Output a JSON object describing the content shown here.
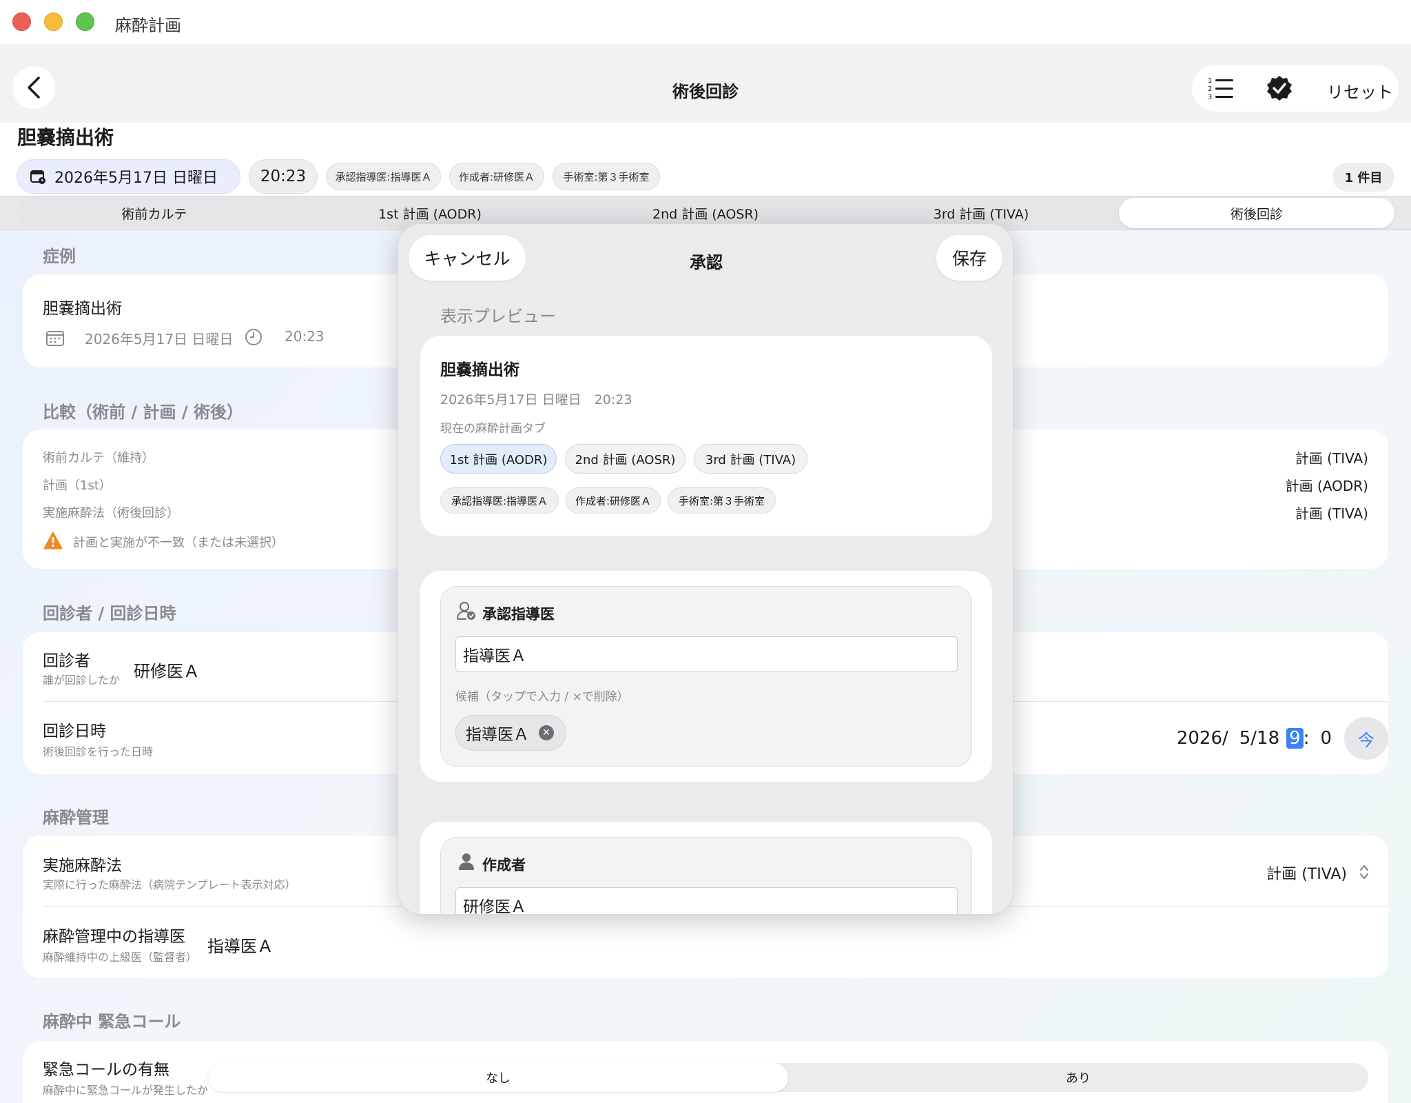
{
  "window": {
    "title": "麻酔計画"
  },
  "nav": {
    "title": "術後回診",
    "reset_label": "リセット"
  },
  "header": {
    "case_title": "胆嚢摘出術",
    "date": "2026年5月17日 日曜日",
    "time": "20:23",
    "chips": {
      "approver": "承認指導医:指導医Ａ",
      "author": "作成者:研修医Ａ",
      "room": "手術室:第３手術室"
    },
    "count": "1 件目"
  },
  "tabs": [
    "術前カルテ",
    "1st 計画 (AODR)",
    "2nd 計画 (AOSR)",
    "3rd 計画 (TIVA)",
    "術後回診"
  ],
  "sections": {
    "case": {
      "heading": "症例",
      "title": "胆嚢摘出術",
      "date": "2026年5月17日 日曜日",
      "time": "20:23"
    },
    "compare": {
      "heading": "比較（術前 / 計画 / 術後）",
      "rows": [
        {
          "label": "術前カルテ（維持）",
          "value": "計画 (TIVA)"
        },
        {
          "label": "計画（1st）",
          "value": "計画 (AODR)"
        },
        {
          "label": "実施麻酔法（術後回診）",
          "value": "計画 (TIVA)"
        }
      ],
      "warning": "計画と実施が不一致（または未選択）"
    },
    "visit": {
      "heading": "回診者 / 回診日時",
      "visitor_label": "回診者",
      "visitor_sub": "誰が回診したか",
      "visitor_value": "研修医Ａ",
      "datetime_label": "回診日時",
      "datetime_sub": "術後回診を行った日時",
      "date_year": "2026/",
      "date_md": "5/18",
      "hour": "9",
      "colon": ":",
      "minute": "0",
      "now_label": "今"
    },
    "anesthesia": {
      "heading": "麻酔管理",
      "method_label": "実施麻酔法",
      "method_sub": "実際に行った麻酔法（病院テンプレート表示対応）",
      "method_value": "計画 (TIVA)",
      "supervisor_label": "麻酔管理中の指導医",
      "supervisor_sub": "麻酔維持中の上級医（監督者）",
      "supervisor_value": "指導医Ａ"
    },
    "emergency": {
      "heading": "麻酔中 緊急コール",
      "label": "緊急コールの有無",
      "sub": "麻酔中に緊急コールが発生したか",
      "options": [
        "なし",
        "あり"
      ]
    }
  },
  "modal": {
    "title": "承認",
    "cancel_label": "キャンセル",
    "save_label": "保存",
    "preview_heading": "表示プレビュー",
    "preview": {
      "title": "胆嚢摘出術",
      "date": "2026年5月17日 日曜日　20:23",
      "caption": "現在の麻酔計画タブ",
      "tabs": [
        "1st 計画 (AODR)",
        "2nd 計画 (AOSR)",
        "3rd 計画 (TIVA)"
      ],
      "chips": {
        "approver": "承認指導医:指導医Ａ",
        "author": "作成者:研修医Ａ",
        "room": "手術室:第３手術室"
      }
    },
    "approver": {
      "heading": "承認指導医",
      "value": "指導医Ａ",
      "candidates_caption": "候補（タップで入力 / ×で削除）",
      "candidates": [
        "指導医Ａ"
      ]
    },
    "author": {
      "heading": "作成者",
      "value": "研修医Ａ"
    }
  },
  "colors": {
    "accent": "#3b82f6",
    "warning": "#f08a24",
    "close": "#ec5f57",
    "minimize": "#f4be3b",
    "maximize": "#5ec44f"
  }
}
